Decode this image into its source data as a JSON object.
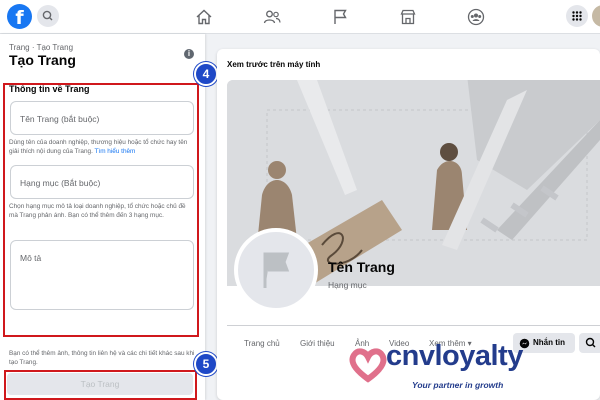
{
  "topbar": {
    "logo_letter": "f",
    "nav_icons": [
      "home-icon",
      "friends-icon",
      "flag-icon",
      "marketplace-icon",
      "groups-icon"
    ]
  },
  "left_panel": {
    "breadcrumb": "Trang · Tạo Trang",
    "title": "Tạo Trang",
    "section_title": "Thông tin về Trang",
    "name_placeholder": "Tên Trang (bắt buộc)",
    "name_hint": "Dùng tên của doanh nghiệp, thương hiệu hoặc tổ chức hay tên giải thích nội dung của Trang.",
    "name_hint_link": "Tìm hiểu thêm",
    "category_placeholder": "Hạng mục (Bắt buộc)",
    "category_hint": "Chọn hạng mục mô tả loại doanh nghiệp, tổ chức hoặc chủ đề mà Trang phản ánh. Bạn có thể thêm đến 3 hạng mục.",
    "description_placeholder": "Mô tả",
    "footer_note": "Bạn có thể thêm ảnh, thông tin liên hệ và các chi tiết khác sau khi tạo Trang.",
    "create_button": "Tạo Trang"
  },
  "annotations": {
    "step_4": "4",
    "step_5": "5",
    "highlight_color": "#d0181c",
    "badge_color": "#1f49c7"
  },
  "preview": {
    "title": "Xem trước trên máy tính",
    "page_name": "Tên Trang",
    "page_category": "Hạng mục",
    "tabs": [
      "Trang chủ",
      "Giới thiệu",
      "Ảnh",
      "Video",
      "Xem thêm ▾"
    ],
    "message_button": "Nhắn tin"
  },
  "watermark": {
    "brand": "cnvloyalty",
    "tagline": "Your partner in growth"
  }
}
